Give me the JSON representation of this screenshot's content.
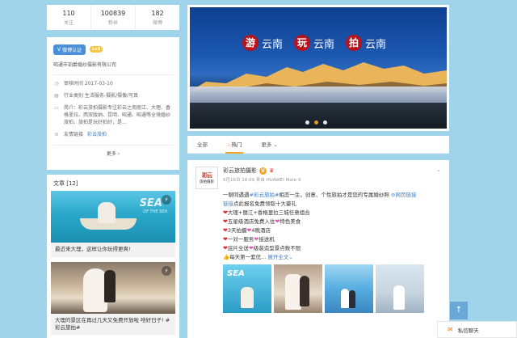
{
  "stats": [
    {
      "num": "110",
      "label": "关注"
    },
    {
      "num": "100839",
      "label": "粉丝"
    },
    {
      "num": "182",
      "label": "微博"
    }
  ],
  "profile": {
    "verify_badge": "微博认证",
    "level_badge": "LvB",
    "company": "昭通市铂爵婚纱摄影有限公司",
    "info": [
      {
        "icon": "clock-icon",
        "text": "审核时间 2017-03-10"
      },
      {
        "icon": "tag-icon",
        "text": "行业类别 生活服务-摄影/摄像/写真"
      },
      {
        "icon": "doc-icon",
        "text": "简介：彩云旅拍摄影专注彩云之南丽江、大理、香格里拉、西双版纳、昆明、昭通、昭通等全境婚纱旅拍，旅拍是玩好拍好，是..."
      },
      {
        "icon": "link-icon",
        "text": "友情链接",
        "link": "彩云旅拍"
      }
    ],
    "more": "更多"
  },
  "articles": {
    "header": "文章 [12]",
    "items": [
      {
        "title": "最近来大理，这样让你玩得更爽!",
        "sea": "SEA",
        "sea_sub": "OF THE SEA"
      },
      {
        "title": "大理的景区在再过几天又免费开放啦 啥好日子! #彩云旅拍#"
      }
    ]
  },
  "banner": {
    "slogan": [
      {
        "seal": "游",
        "word": "云南"
      },
      {
        "seal": "玩",
        "word": "云南"
      },
      {
        "seal": "拍",
        "word": "云南"
      }
    ]
  },
  "tabs": [
    {
      "label": "全部"
    },
    {
      "label": "热门"
    },
    {
      "label": "更多"
    }
  ],
  "post": {
    "avatar_top": "彩云",
    "avatar_bottom": "旅拍摄影",
    "nickname": "彩云旅拍摄影",
    "meta": "6月16日 16:09 来自 HUAWEI Mate 9",
    "line1_a": "一聊同遇遇",
    "line1_tag": "#彩云旅拍#",
    "line1_b": "相恋一生，创意、个性旅拍才是您的专属婚纱照",
    "line1_link": "网页链接",
    "line1_c": "点此报名免费领取十大豪礼",
    "items": [
      "大理+丽江+香格里拉三城任意组合",
      "五星级酒店免费入住",
      "3天拍摄",
      "一对一服务",
      "底片全送",
      "每天第一套优..."
    ],
    "item_suffix": [
      "",
      "特色美食",
      "4晚酒店",
      "接送机",
      "级装造型景点数不限",
      ""
    ],
    "expand": "展开全文",
    "thumb_sea": "SEA"
  },
  "float": {
    "scroll_top": "↑",
    "chat": "私信聊天"
  }
}
